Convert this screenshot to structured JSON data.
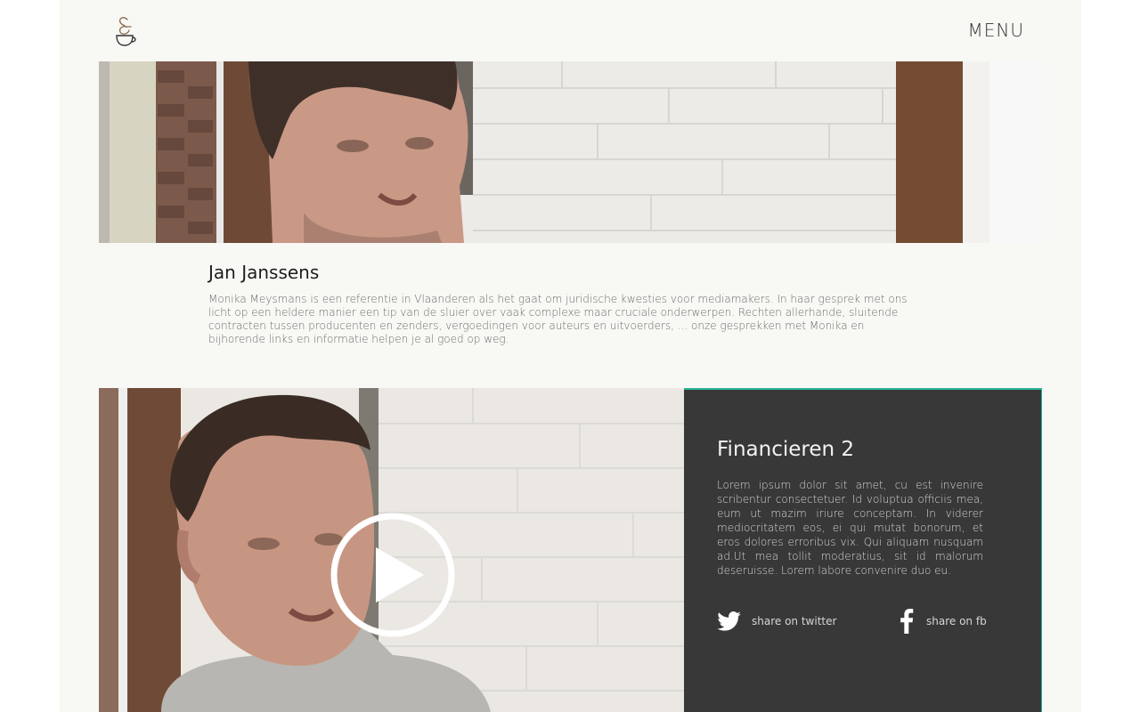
{
  "header": {
    "menu_label": "MENU"
  },
  "profile": {
    "name": "Jan Janssens",
    "bio": "Monika Meysmans is een referentie in Vlaanderen als het gaat om juridische kwesties voor mediamakers. In haar gesprek met ons licht op een heldere manier een tip van de sluier over vaak complexe maar cruciale onderwerpen. Rechten allerhande, sluitende contracten tussen producenten en zenders, vergoedingen voor auteurs en uitvoerders, ... onze gesprekken met Monika en bijhorende links en informatie helpen je al goed op weg."
  },
  "video_card": {
    "title": "Financieren 2",
    "description": "Lorem ipsum dolor sit amet, cu est invenire scribentur consectetuer. Id voluptua officiis mea, eum ut mazim iriure conceptam. In viderer mediocritatem eos, ei qui mutat bonorum, et eros dolores erroribus vix. Qui aliquam nusquam ad.Ut mea tollit moderatius, sit id malorum deseruisse. Lorem labore convenire duo eu.",
    "share_twitter_label": "share on twitter",
    "share_fb_label": "share on fb"
  },
  "colors": {
    "page_bg": "#f8f8f4",
    "panel_bg": "#383838",
    "accent": "#2bb596",
    "logo": "#8a6a4f"
  },
  "icons": [
    "ampersand-cup-logo",
    "play-icon",
    "twitter-icon",
    "facebook-icon"
  ]
}
